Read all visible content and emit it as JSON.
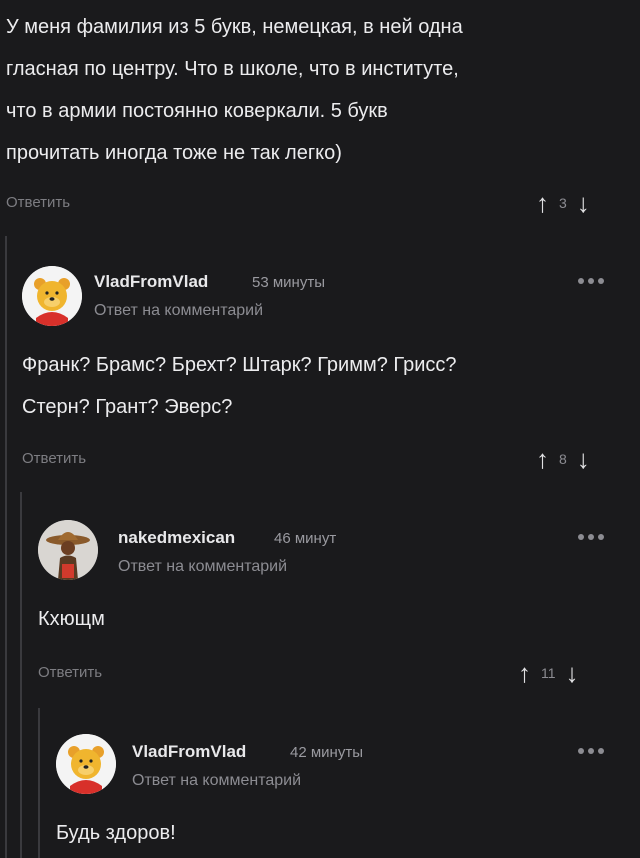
{
  "top_comment": {
    "lines": [
      "У меня фамилия из 5 букв, немецкая, в ней одна",
      "гласная по центру. Что в школе, что в институте,",
      "что в армии постоянно коверкали. 5 букв",
      "прочитать иногда тоже не так легко)"
    ],
    "reply_label": "Ответить",
    "vote_count": "3"
  },
  "comments": [
    {
      "username": "VladFromVlad",
      "time": "53 минуты",
      "subline": "Ответ на комментарий",
      "lines": [
        "Франк? Брамс? Брехт? Штарк? Гримм? Грисс?",
        "Стерн? Грант? Эверс?"
      ],
      "reply_label": "Ответить",
      "vote_count": "8"
    },
    {
      "username": "nakedmexican",
      "time": "46 минут",
      "subline": "Ответ на комментарий",
      "lines": [
        "Кхющм"
      ],
      "reply_label": "Ответить",
      "vote_count": "11"
    },
    {
      "username": "VladFromVlad",
      "time": "42 минуты",
      "subline": "Ответ на комментарий",
      "lines": [
        "Будь здоров!"
      ]
    }
  ],
  "icons": {
    "upvote": "arrow-up-icon",
    "downvote": "arrow-down-icon",
    "more": "more-dots-icon"
  },
  "colors": {
    "background": "#1a1a1c",
    "thread_line": "#3a3a3e"
  }
}
